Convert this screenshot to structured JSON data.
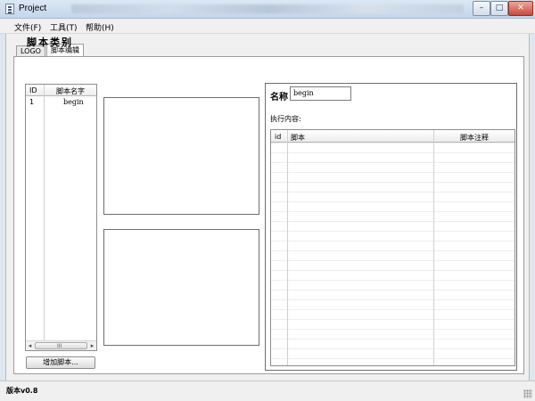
{
  "window": {
    "title": "Project",
    "controls": {
      "minimize": "–",
      "maximize": "□",
      "close": "✕"
    }
  },
  "menu": {
    "items": [
      "文件(F)",
      "工具(T)",
      "帮助(H)"
    ]
  },
  "tabs": {
    "logo": "LOGO",
    "script_edit": "脚本编辑"
  },
  "categories": {
    "title": "脚本类别",
    "columns": {
      "id": "ID",
      "name": "脚本名字"
    },
    "rows": [
      {
        "id": "1",
        "name": "begin"
      }
    ],
    "scroll": {
      "left": "◂",
      "right": "▸",
      "grip": "III"
    },
    "add_button": "增加脚本..."
  },
  "editor": {
    "name_label": "名称",
    "name_value": "begin",
    "exec_label": "执行内容:",
    "columns": {
      "id": "id",
      "script": "脚本",
      "note": "脚本注释"
    }
  },
  "status": {
    "version": "版本v0.8"
  }
}
